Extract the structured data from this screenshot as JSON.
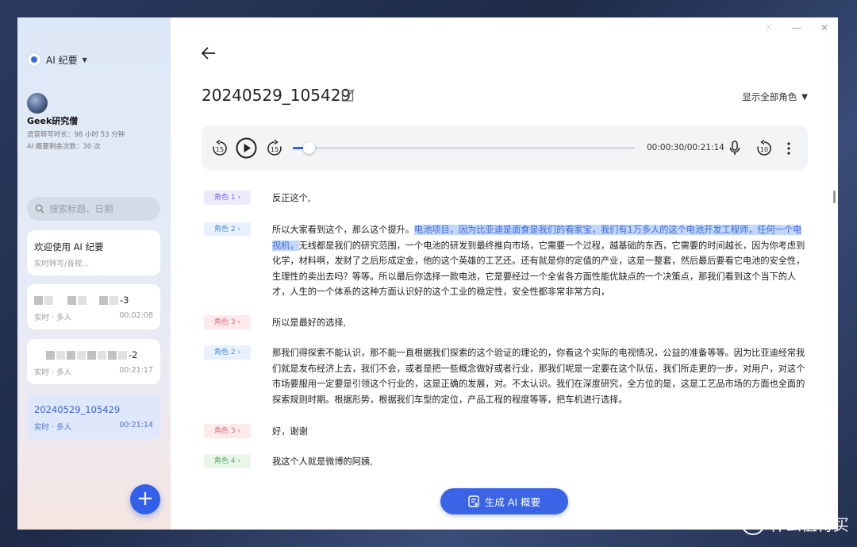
{
  "sidebar": {
    "app_name": "AI 纪要",
    "user": {
      "name": "Geek研究僧",
      "transcribe_time": "语音转写时长：98 小时 53 分钟",
      "summary_count": "AI 概要剩余次数：30 次"
    },
    "search_placeholder": "搜索标题、日期",
    "records": [
      {
        "title": "欢迎使用 AI 纪要",
        "sub": "实时转写/音视...",
        "duration": ""
      },
      {
        "title_suffix": "-3",
        "sub": "实时 · 多人",
        "duration": "00:02:08"
      },
      {
        "title_suffix": "-2",
        "sub": "实时 · 多人",
        "duration": "00:21:17"
      },
      {
        "title": "20240529_105429",
        "sub": "实时 · 多人",
        "duration": "00:21:14"
      }
    ],
    "fab_label": "+"
  },
  "main": {
    "record_name": "20240529_105429",
    "role_filter": "显示全部角色",
    "player": {
      "time": "00:00:30/00:21:14",
      "progress": 0.035,
      "rewind_seconds": "15",
      "forward_seconds": "15",
      "replay_seconds": "10"
    },
    "segments": [
      {
        "role": "角色 1",
        "role_class": "role-1",
        "text": "反正这个,"
      },
      {
        "role": "角色 2",
        "role_class": "role-2",
        "pre": "所以大家看到这个，那么这个提升。",
        "highlight": "电池项目，因为比亚迪是面食是我们的看家宝，我们有1万多人的这个电池开发工程师，任何一个电视机，",
        "post": "无线都是我们的研究范围，一个电池的研发到最终推向市场，它需要一个过程，越基础的东西，它需要的时间越长，因为你考虑到化学，材料啊，发财了之后形成定金，他的这个英雄的工艺还。还有就是你的定值的产业，这是一整套，然后最后要看它电池的安全性，生理性的卖出去吗？等等。所以最后你选择一款电池，它是要经过一个全省各方面性能优缺点的一个决策点，那我们看到这个当下的人才，人生的一个体系的这种方面认识好的这个工业的稳定性，安全性都非常非常方向，"
      },
      {
        "role": "角色 3",
        "role_class": "role-3",
        "text": "所以是最好的选择,"
      },
      {
        "role": "角色 2",
        "role_class": "role-2",
        "text": "那我们得探索不能认识，那不能一直根据我们探索的这个验证的理论的，你看这个实际的电视情况，公益的准备等等。因为比亚迪经常我们就是发布经济上去，我们不会，或者是把一些概念做好或者行业，那我们呢是一定要在这个队伍，我们所走更的一步，对用户，对这个市场要服用一定要是引领这个行业的，这是正确的发展，对。不太认识。我们在深度研究，全方位的是，这是工艺品市场的方面也全面的探索规则时期。根据形势，根据我们车型的定位，产品工程的程度等等，把车机进行选择。"
      },
      {
        "role": "角色 3",
        "role_class": "role-3",
        "text": "好，谢谢"
      },
      {
        "role": "角色 4",
        "role_class": "role-4",
        "text": "我这个人就是微博的阿姨,"
      }
    ],
    "generate_button": "生成 AI 概要"
  },
  "watermark": "什么值得买",
  "icons": {
    "back": "back-arrow-icon",
    "edit": "edit-icon",
    "play": "play-icon",
    "mic": "microphone-icon",
    "more": "more-vertical-icon"
  }
}
